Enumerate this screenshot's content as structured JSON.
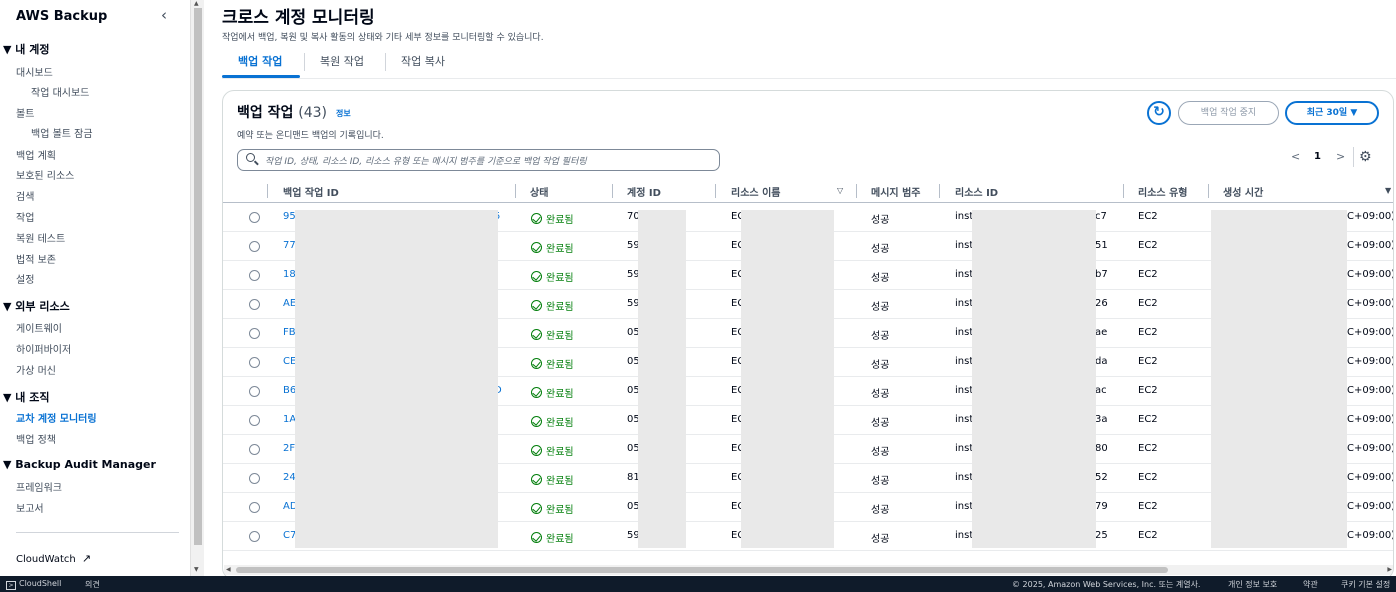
{
  "sidebar": {
    "title": "AWS Backup",
    "collapse_icon": "chevron-left-icon",
    "sections": [
      {
        "label": "▼ 내 계정"
      },
      {
        "label": "▼ 외부 리소스"
      },
      {
        "label": "▼ 내 조직"
      },
      {
        "label": "▼ Backup Audit Manager"
      }
    ],
    "items": [
      {
        "label": "대시보드"
      },
      {
        "label": "작업 대시보드"
      },
      {
        "label": "볼트"
      },
      {
        "label": "백업 볼트 잠금"
      },
      {
        "label": "백업 계획"
      },
      {
        "label": "보호된 리소스"
      },
      {
        "label": "검색"
      },
      {
        "label": "작업"
      },
      {
        "label": "복원 테스트"
      },
      {
        "label": "법적 보존"
      },
      {
        "label": "설정"
      },
      {
        "label": "게이트웨이"
      },
      {
        "label": "하이퍼바이저"
      },
      {
        "label": "가상 머신"
      },
      {
        "label": "교차 계정 모니터링"
      },
      {
        "label": "백업 정책"
      },
      {
        "label": "프레임워크"
      },
      {
        "label": "보고서"
      }
    ],
    "cloudwatch": "CloudWatch",
    "cloudwatch_icon": "external-link-icon"
  },
  "page": {
    "title": "크로스 계정 모니터링",
    "description": "작업에서 백업, 복원 및 복사 활동의 상태와 기타 세부 정보를 모니터링할 수 있습니다."
  },
  "tabs": [
    {
      "label": "백업 작업",
      "active": true
    },
    {
      "label": "복원 작업",
      "active": false
    },
    {
      "label": "작업 복사",
      "active": false
    }
  ],
  "container": {
    "title": "백업 작업",
    "count": "(43)",
    "info": "정보",
    "description": "예약 또는 온디맨드 백업의 기록입니다.",
    "stop_button": "백업 작업 중지",
    "range_button": "최근 30일 ▼",
    "refresh_icon": "refresh-icon",
    "search_placeholder": "작업 ID, 상태, 리소스 ID, 리소스 유형 또는 메시지 범주를 기준으로 백업 작업 필터링",
    "page_prev": "<",
    "page_current": "1",
    "page_next": ">",
    "settings_icon": "gear-icon"
  },
  "table": {
    "columns": [
      "백업 작업 ID",
      "상태",
      "계정 ID",
      "리소스 이름",
      "메시지 범주",
      "리소스 ID",
      "리소스 유형",
      "생성 시간"
    ],
    "rows": [
      {
        "id": "95",
        "id_tail": "5",
        "status": "완료됨",
        "account": "70",
        "resource_name": "EC",
        "message": "성공",
        "resource_id": "inst",
        "rid_tail": "c7",
        "type": "EC2",
        "created": "C+09:00)"
      },
      {
        "id": "77",
        "id_tail": "",
        "status": "완료됨",
        "account": "59",
        "resource_name": "EC",
        "message": "성공",
        "resource_id": "inst",
        "rid_tail": "51",
        "type": "EC2",
        "created": "C+09:00)"
      },
      {
        "id": "18",
        "id_tail": "",
        "status": "완료됨",
        "account": "59",
        "resource_name": "EC",
        "message": "성공",
        "resource_id": "inst",
        "rid_tail": "b7",
        "type": "EC2",
        "created": "C+09:00)"
      },
      {
        "id": "AE",
        "id_tail": "",
        "status": "완료됨",
        "account": "59",
        "resource_name": "EC",
        "message": "성공",
        "resource_id": "inst",
        "rid_tail": "26",
        "type": "EC2",
        "created": "C+09:00)"
      },
      {
        "id": "FB",
        "id_tail": "",
        "status": "완료됨",
        "account": "05",
        "resource_name": "EC",
        "message": "성공",
        "resource_id": "inst",
        "rid_tail": "ae",
        "type": "EC2",
        "created": "C+09:00)"
      },
      {
        "id": "CE",
        "id_tail": "",
        "status": "완료됨",
        "account": "05",
        "resource_name": "EC",
        "message": "성공",
        "resource_id": "inst",
        "rid_tail": "da",
        "type": "EC2",
        "created": "C+09:00)"
      },
      {
        "id": "B6",
        "id_tail": "D",
        "status": "완료됨",
        "account": "05",
        "resource_name": "EC",
        "message": "성공",
        "resource_id": "inst",
        "rid_tail": "ac",
        "type": "EC2",
        "created": "C+09:00)"
      },
      {
        "id": "1A",
        "id_tail": "",
        "status": "완료됨",
        "account": "05",
        "resource_name": "EC",
        "message": "성공",
        "resource_id": "inst",
        "rid_tail": "3a",
        "type": "EC2",
        "created": "C+09:00)"
      },
      {
        "id": "2F",
        "id_tail": "",
        "status": "완료됨",
        "account": "05",
        "resource_name": "EC",
        "message": "성공",
        "resource_id": "inst",
        "rid_tail": "80",
        "type": "EC2",
        "created": "C+09:00)"
      },
      {
        "id": "24",
        "id_tail": "",
        "status": "완료됨",
        "account": "81",
        "resource_name": "EC",
        "message": "성공",
        "resource_id": "inst",
        "rid_tail": "52",
        "type": "EC2",
        "created": "C+09:00)"
      },
      {
        "id": "AD",
        "id_tail": "",
        "status": "완료됨",
        "account": "05",
        "resource_name": "EC",
        "message": "성공",
        "resource_id": "inst",
        "rid_tail": "79",
        "type": "EC2",
        "created": "C+09:00)"
      },
      {
        "id": "C7",
        "id_tail": "",
        "status": "완료됨",
        "account": "59",
        "resource_name": "EC",
        "message": "성공",
        "resource_id": "inst",
        "rid_tail": "25",
        "type": "EC2",
        "created": "C+09:00)"
      }
    ]
  },
  "footer": {
    "cloudshell": "CloudShell",
    "feedback": "의견",
    "copyright": "© 2025, Amazon Web Services, Inc. 또는 계열사.",
    "privacy": "개인 정보 보호",
    "terms": "약관",
    "cookies": "쿠키 기본 설정"
  }
}
